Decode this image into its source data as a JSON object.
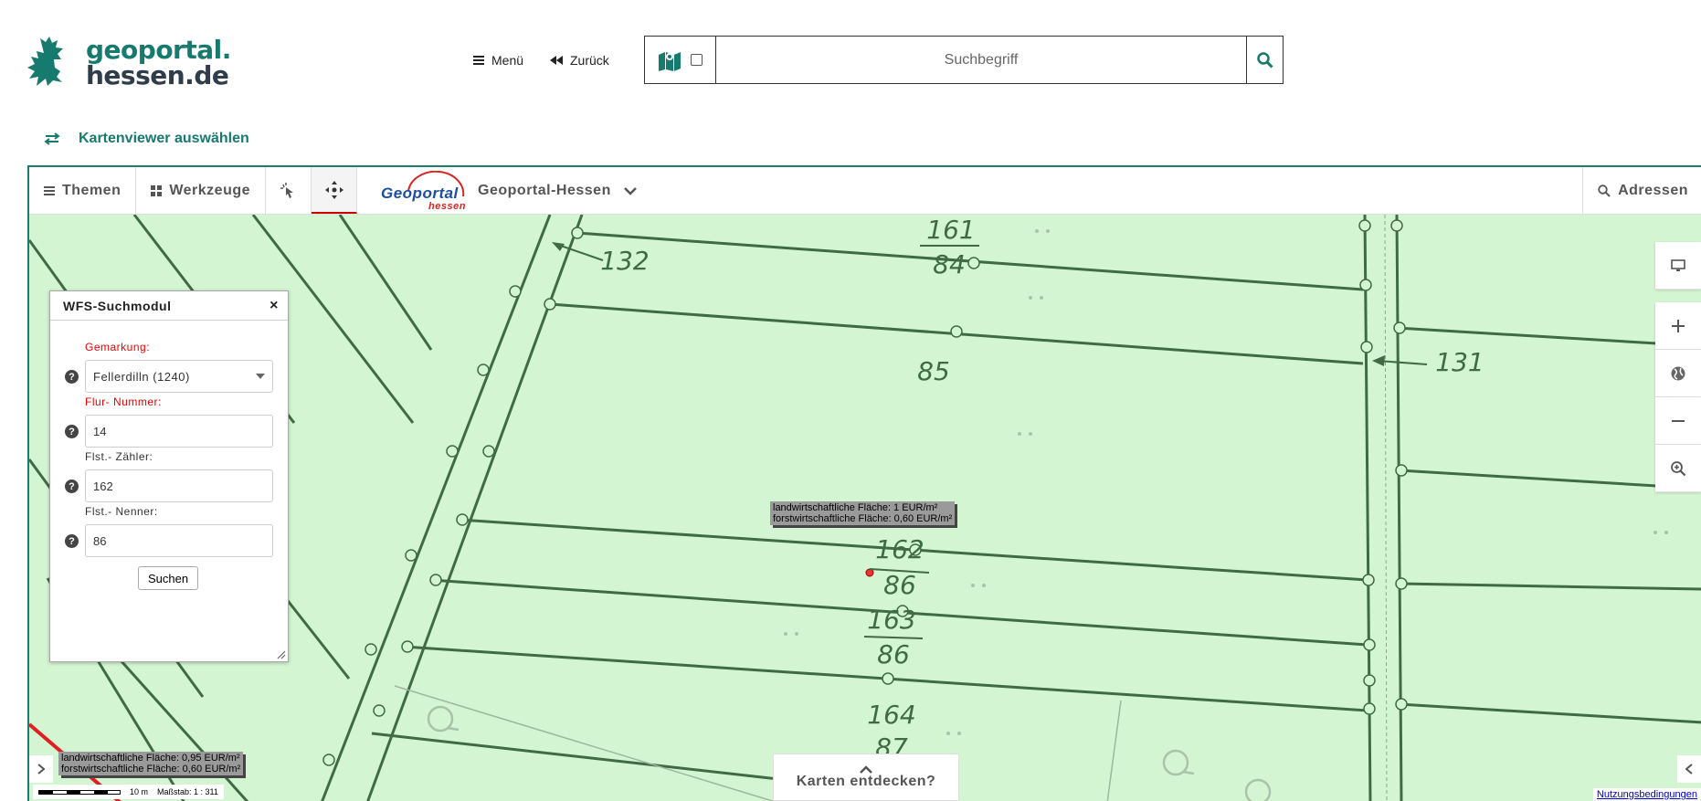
{
  "header": {
    "logo_line1": "geoportal.",
    "logo_line2": "hessen.de",
    "menu_label": "Menü",
    "back_label": "Zurück",
    "search_placeholder": "Suchbegriff"
  },
  "viewer_select_label": "Kartenviewer auswählen",
  "toolbar": {
    "themes_label": "Themen",
    "tools_label": "Werkzeuge",
    "geoportal_logo_main": "Geoportal",
    "geoportal_logo_sub": "hessen",
    "geoportal_label": "Geoportal-Hessen",
    "addresses_label": "Adressen"
  },
  "wfs": {
    "title": "WFS-Suchmodul",
    "close": "×",
    "gemarkung_label": "Gemarkung:",
    "gemarkung_value": "Fellerdilln (1240)",
    "flur_label": "Flur- Nummer:",
    "flur_value": "14",
    "zaehler_label": "Flst.- Zähler:",
    "zaehler_value": "162",
    "nenner_label": "Flst.- Nenner:",
    "nenner_value": "86",
    "submit_label": "Suchen"
  },
  "map": {
    "parcel_labels": [
      "84",
      "161",
      "84",
      "85",
      "162",
      "86",
      "163",
      "86",
      "164",
      "87",
      "132",
      "131"
    ],
    "tooltip_center_line1": "landwirtschaftliche Fläche: 1 EUR/m²",
    "tooltip_center_line2": "forstwirtschaftliche Fläche: 0,60 EUR/m²",
    "tooltip_left_line1": "landwirtschaftliche Fläche: 0,95 EUR/m²",
    "tooltip_left_line2": "forstwirtschaftliche Fläche: 0,60 EUR/m²",
    "discover_label": "Karten entdecken?",
    "scale_distance": "10 m",
    "scale_text": "Maßstab: 1 : 311",
    "terms_link": "Nutzungsbedingungen"
  },
  "colors": {
    "brand": "#167a6e",
    "map_background": "#d4f5d2",
    "parcel_line": "#3f6b44",
    "required": "#ee0000"
  }
}
